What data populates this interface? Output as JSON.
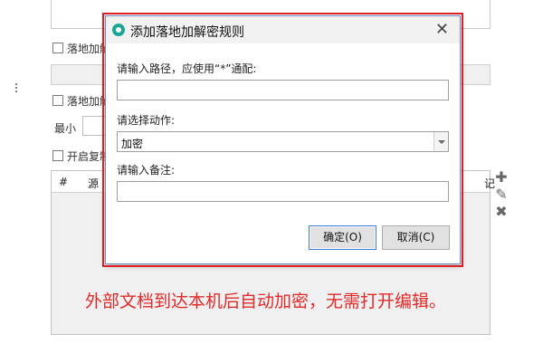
{
  "background": {
    "checkbox1_label": "落地加解",
    "checkbox2_label": "落地加解",
    "min_label": "最小",
    "checkbox3_label": "开启复制",
    "table_headers": [
      "#",
      "源"
    ],
    "table_header_right": "记"
  },
  "side_tools": {
    "add_icon": "plus-icon",
    "edit_icon": "pencil-icon",
    "delete_icon": "x-icon"
  },
  "dialog": {
    "title": "添加落地加解密规则",
    "close_glyph": "✕",
    "path_label": "请输入路径，应使用“*”通配:",
    "path_value": "",
    "action_label": "请选择动作:",
    "action_selected": "加密",
    "note_label": "请输入备注:",
    "note_value": "",
    "ok_label": "确定(O)",
    "cancel_label": "取消(C)",
    "accent_color": "#e02020"
  },
  "caption": "外部文档到达本机后自动加密，无需打开编辑。"
}
